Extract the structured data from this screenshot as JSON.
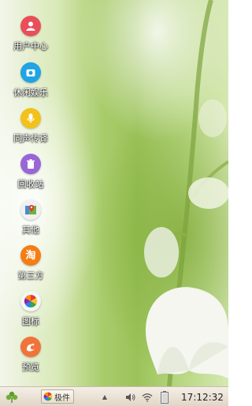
{
  "desktop": {
    "icons": [
      {
        "label": "用户中心",
        "icon": "user-icon",
        "color": "#ea4f59"
      },
      {
        "label": "休闲娱乐",
        "icon": "camera-icon",
        "color": "#1fa4e6"
      },
      {
        "label": "同声传译",
        "icon": "microphone-icon",
        "color": "#f2c21b"
      },
      {
        "label": "回收站",
        "icon": "trash-icon",
        "color": "#9966d6"
      },
      {
        "label": "其他",
        "icon": "map-pin-icon",
        "color": "#f0f0f0"
      },
      {
        "label": "第三方",
        "icon": "taobao-icon",
        "color": "#f57d14"
      },
      {
        "label": "图标",
        "icon": "pinwheel-icon",
        "color": "#f5f5f5"
      },
      {
        "label": "预览",
        "icon": "uc-browser-icon",
        "color": "#f0743a"
      }
    ]
  },
  "taskbar": {
    "start_icon": "clover-icon",
    "app_button_label": "极件",
    "tray_arrow": "▲",
    "clock": "17:12:32",
    "accent": "#e0d6c6"
  }
}
